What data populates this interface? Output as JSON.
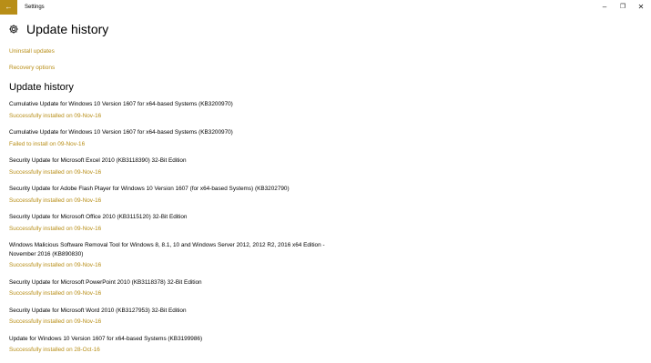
{
  "window": {
    "title": "Settings",
    "back_glyph": "←",
    "minimize_glyph": "–",
    "maximize_glyph": "❐",
    "close_glyph": "✕"
  },
  "header": {
    "icon": "gear-icon",
    "title": "Update history"
  },
  "links": {
    "uninstall": "Uninstall updates",
    "recovery": "Recovery options"
  },
  "section": {
    "title": "Update history"
  },
  "colors": {
    "accent": "#b88e17",
    "text": "#000000",
    "background": "#ffffff"
  },
  "updates": [
    {
      "name": "Cumulative Update for Windows 10 Version 1607 for x64-based Systems (KB3200970)",
      "status": "Successfully installed on 09-Nov-16"
    },
    {
      "name": "Cumulative Update for Windows 10 Version 1607 for x64-based Systems (KB3200970)",
      "status": "Failed to install on 09-Nov-16"
    },
    {
      "name": "Security Update for Microsoft Excel 2010 (KB3118390) 32-Bit Edition",
      "status": "Successfully installed on 09-Nov-16"
    },
    {
      "name": "Security Update for Adobe Flash Player for Windows 10 Version 1607 (for x64-based Systems) (KB3202790)",
      "status": "Successfully installed on 09-Nov-16"
    },
    {
      "name": "Security Update for Microsoft Office 2010 (KB3115120) 32-Bit Edition",
      "status": "Successfully installed on 09-Nov-16"
    },
    {
      "name": "Windows Malicious Software Removal Tool for Windows 8, 8.1, 10 and Windows Server 2012, 2012 R2, 2016 x64 Edition - November 2016 (KB890830)",
      "status": "Successfully installed on 09-Nov-16"
    },
    {
      "name": "Security Update for Microsoft PowerPoint 2010 (KB3118378) 32-Bit Edition",
      "status": "Successfully installed on 09-Nov-16"
    },
    {
      "name": "Security Update for Microsoft Word 2010 (KB3127953) 32-Bit Edition",
      "status": "Successfully installed on 09-Nov-16"
    },
    {
      "name": "Update for Windows 10 Version 1607 for x64-based Systems (KB3199986)",
      "status": "Successfully installed on 28-Oct-16"
    }
  ]
}
